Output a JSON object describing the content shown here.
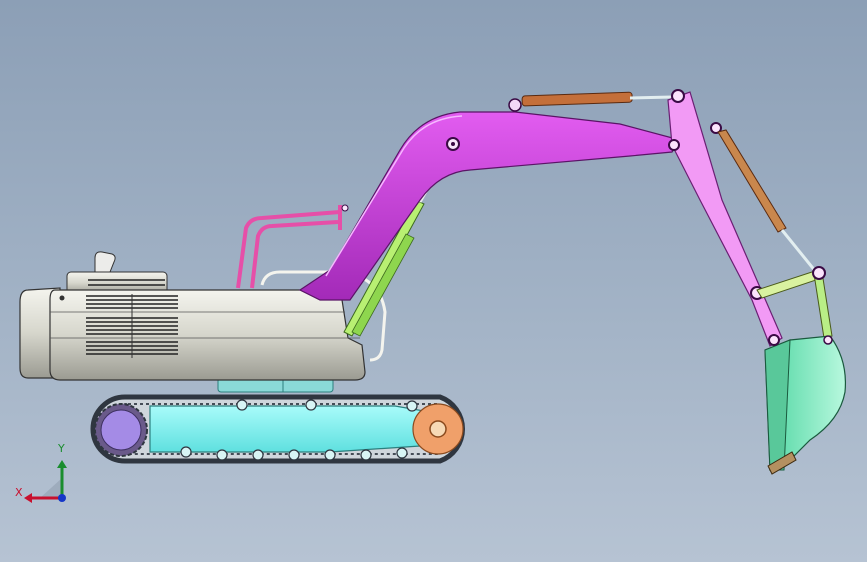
{
  "viewport": {
    "background_top": "#8c9fb6",
    "background_bottom": "#b6c3d3"
  },
  "triad": {
    "x_label": "X",
    "y_label": "Y",
    "x_color": "#c8102e",
    "y_color": "#1a8d2e",
    "z_color": "#1436c8"
  },
  "parts": {
    "boom": {
      "color": "#c23bd7"
    },
    "arm": {
      "color": "#f29af5"
    },
    "bucket": {
      "color": "#8df0c4"
    },
    "bucket_link": {
      "color": "#b9ee86"
    },
    "boom_cylinder": {
      "color": "#b8f072"
    },
    "arm_cylinder": {
      "color": "#b86a3a"
    },
    "bucket_cylinder": {
      "color": "#c9874d"
    },
    "cab_frame": {
      "color": "#e64fa8"
    },
    "undercarriage": {
      "color": "#7df3f2"
    },
    "drive_sprocket": {
      "color": "#a48be6"
    },
    "idler": {
      "color": "#f0a06a"
    },
    "engine_body": {
      "color": "#e8e8e0"
    },
    "track": {
      "color": "#2f3640"
    }
  }
}
